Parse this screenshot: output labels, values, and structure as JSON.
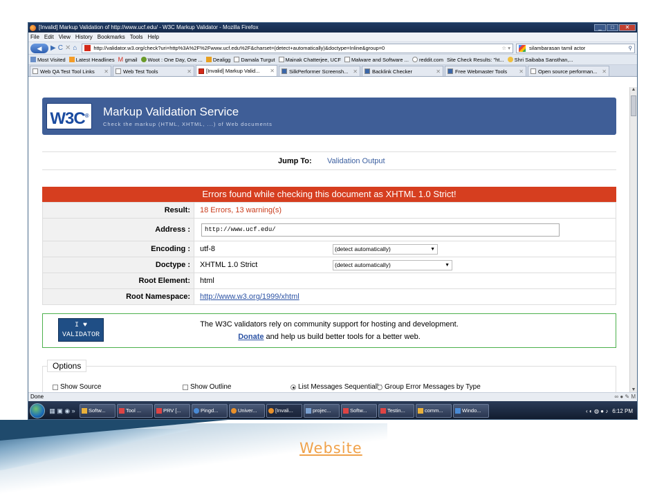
{
  "window": {
    "title": "[Invalid] Markup Validation of http://www.ucf.edu/ - W3C Markup Validator - Mozilla Firefox",
    "buttons": [
      "_",
      "□",
      "✕"
    ]
  },
  "menu": [
    "File",
    "Edit",
    "View",
    "History",
    "Bookmarks",
    "Tools",
    "Help"
  ],
  "nav": {
    "back": "◀",
    "forward": "▶",
    "reload": "C",
    "stop": "✕",
    "home": "⌂",
    "url": "http://validator.w3.org/check?uri=http%3A%2F%2Fwww.ucf.edu%2F&charset=(detect+automatically)&doctype=Inline&group=0",
    "search_value": "silambarasan tamil actor"
  },
  "bookmarks": [
    "Most Visited",
    "Latest Headlines",
    "gmail",
    "Woot : One Day, One ...",
    "Dealigg",
    "Damala Turgut",
    "Mainak Chatterjee, UCF",
    "Malware and Software ...",
    "reddit.com",
    "Site Check Results: \"ht...",
    "Shri Saibaba Sansthan,..."
  ],
  "tabs": [
    {
      "label": "Web QA Test Tool Links",
      "active": false
    },
    {
      "label": "Web Test Tools",
      "active": false
    },
    {
      "label": "[Invalid] Markup Valid...",
      "active": true
    },
    {
      "label": "SilkPerformer Screensh...",
      "active": false
    },
    {
      "label": "Backlink Checker",
      "active": false
    },
    {
      "label": "Free Webmaster Tools",
      "active": false
    },
    {
      "label": "Open source performan...",
      "active": false
    }
  ],
  "w3c": {
    "logo": "W3C",
    "logo_mark": "®",
    "title": "Markup Validation Service",
    "subtitle": "Check the markup (HTML, XHTML, ...) of Web documents"
  },
  "jump": {
    "label": "Jump To:",
    "link": "Validation Output"
  },
  "error_banner": "Errors found while checking this document as XHTML 1.0 Strict!",
  "results": {
    "result_label": "Result:",
    "result_value": "18 Errors, 13 warning(s)",
    "address_label": "Address :",
    "address_value": "http://www.ucf.edu/",
    "encoding_label": "Encoding :",
    "encoding_value": "utf-8",
    "encoding_select": "(detect automatically)",
    "doctype_label": "Doctype :",
    "doctype_value": "XHTML 1.0 Strict",
    "doctype_select": "(detect automatically)",
    "root_element_label": "Root Element:",
    "root_element_value": "html",
    "root_namespace_label": "Root Namespace:",
    "root_namespace_value": "http://www.w3.org/1999/xhtml"
  },
  "support": {
    "badge_line1": "I ♥",
    "badge_line2": "VALIDATOR",
    "line1": "The W3C validators rely on community support for hosting and development.",
    "donate": "Donate",
    "line2_rest": " and help us build better tools for a better web."
  },
  "options": {
    "legend": "Options",
    "show_source": "Show Source",
    "show_outline": "Show Outline",
    "list_sequential": "List Messages Sequentially",
    "group_error": "Group Error Messages by Type"
  },
  "status": {
    "text": "Done"
  },
  "taskbar": {
    "items": [
      "Softw...",
      "Tool ...",
      "PRV [...",
      "Pingd...",
      "Univer...",
      "[Invali...",
      "projec...",
      "Softw...",
      "Testin...",
      "comm...",
      "Windo..."
    ],
    "time": "6:12 PM"
  },
  "footer_link": "Website",
  "colors": {
    "w3c_blue": "#3f5e97",
    "error_red": "#d63e1f",
    "support_green": "#4bb04b",
    "link_orange": "#f0a24a"
  }
}
